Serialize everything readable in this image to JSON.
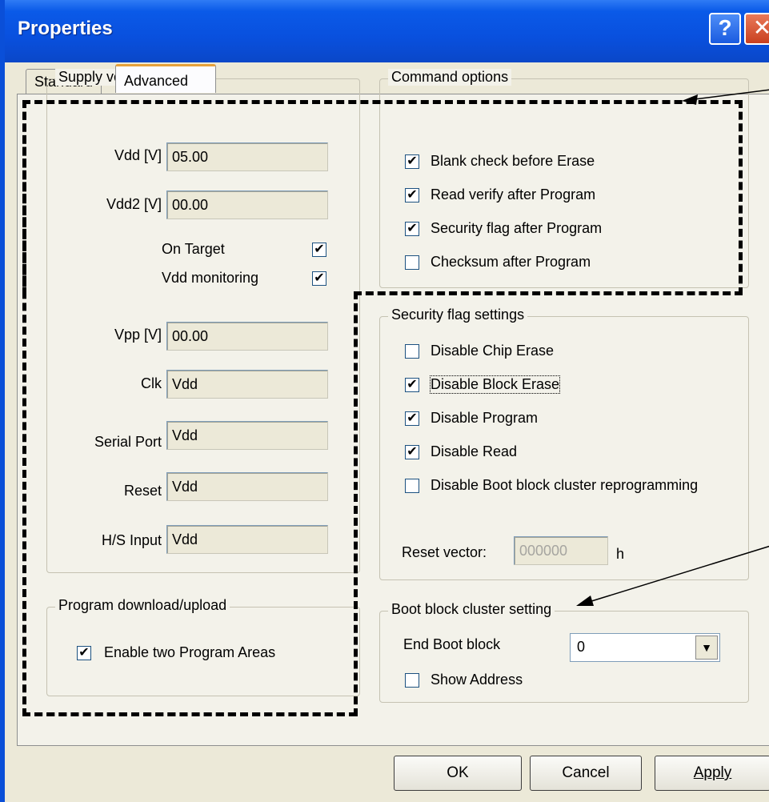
{
  "window": {
    "title": "Properties"
  },
  "titlebar": {
    "help_glyph": "?",
    "close_glyph": "✕"
  },
  "tabs": [
    {
      "label": "Standard"
    },
    {
      "label": "Advanced"
    }
  ],
  "supply_voltage": {
    "title": "Supply voltage",
    "vdd": {
      "label": "Vdd [V]",
      "value": "05.00"
    },
    "vdd2": {
      "label": "Vdd2 [V]",
      "value": "00.00"
    },
    "on_target": {
      "label": "On Target",
      "checked": true
    },
    "vdd_monitoring": {
      "label": "Vdd monitoring",
      "checked": true
    },
    "vpp": {
      "label": "Vpp [V]",
      "value": "00.00"
    },
    "clk": {
      "label": "Clk",
      "value": "Vdd"
    },
    "serial_port": {
      "label": "Serial Port",
      "value": "Vdd"
    },
    "reset": {
      "label": "Reset",
      "value": "Vdd"
    },
    "hs_input": {
      "label": "H/S Input",
      "value": "Vdd"
    }
  },
  "program_download": {
    "title": "Program download/upload",
    "enable_two_areas": {
      "label": "Enable two Program Areas",
      "checked": true
    }
  },
  "command_options": {
    "title": "Command options",
    "items": [
      {
        "label": "Blank check before Erase",
        "checked": true
      },
      {
        "label": "Read verify after Program",
        "checked": true
      },
      {
        "label": "Security flag after Program",
        "checked": true
      },
      {
        "label": "Checksum after Program",
        "checked": false
      }
    ]
  },
  "security_flags": {
    "title": "Security flag settings",
    "items": [
      {
        "label": "Disable Chip Erase",
        "checked": false
      },
      {
        "label": "Disable Block Erase",
        "checked": true
      },
      {
        "label": "Disable Program",
        "checked": true
      },
      {
        "label": "Disable Read",
        "checked": true
      },
      {
        "label": "Disable Boot block cluster reprogramming",
        "checked": false
      }
    ],
    "reset_vector": {
      "label": "Reset vector:",
      "value": "000000",
      "suffix": "h"
    }
  },
  "boot_block": {
    "title": "Boot block cluster setting",
    "end_boot_block": {
      "label": "End Boot block",
      "value": "0"
    },
    "show_address": {
      "label": "Show Address",
      "checked": false
    }
  },
  "buttons": {
    "ok": "OK",
    "cancel": "Cancel",
    "apply": "Apply"
  },
  "check_glyph": "✔"
}
